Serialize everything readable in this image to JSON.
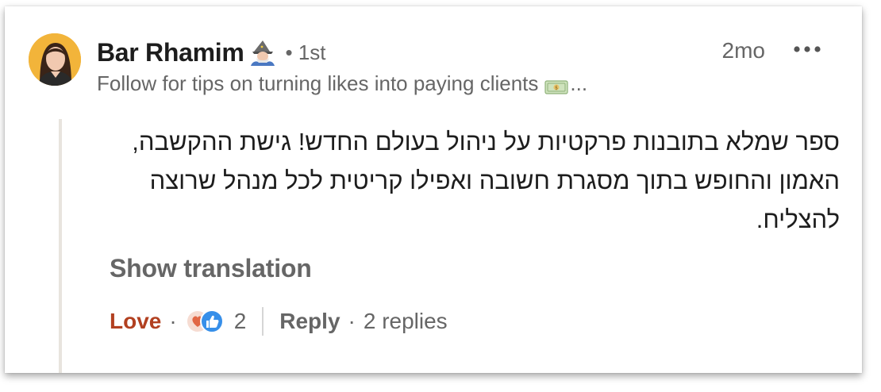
{
  "comment": {
    "author": {
      "name": "Bar Rhamim",
      "badge_icon": "wizard-emoji-icon",
      "degree": "• 1st",
      "headline": "Follow for tips on turning likes into paying clients",
      "headline_icon": "money-bag-emoji-icon",
      "headline_ellipsis": "...",
      "avatar_bg": "#f2b43a"
    },
    "timestamp": "2mo",
    "more_icon": "more-options-icon",
    "text": "ספר שמלא בתובנות פרקטיות על ניהול בעולם החדש! גישת ההקשבה, האמון והחופש בתוך מסגרת חשובה ואפילו קריטית לכל מנהל שרוצה להצליח.",
    "show_translation": "Show translation",
    "actions": {
      "love_label": "Love",
      "dot": "·",
      "reaction_icons": [
        "love-reaction-icon",
        "like-reaction-icon"
      ],
      "reaction_count": "2",
      "reply_label": "Reply",
      "dot2": "·",
      "replies_label": "2 replies"
    },
    "colors": {
      "love_accent": "#b24020",
      "like_blue": "#378fe9",
      "text_primary": "#1d1d1d",
      "text_secondary": "#666666"
    }
  }
}
